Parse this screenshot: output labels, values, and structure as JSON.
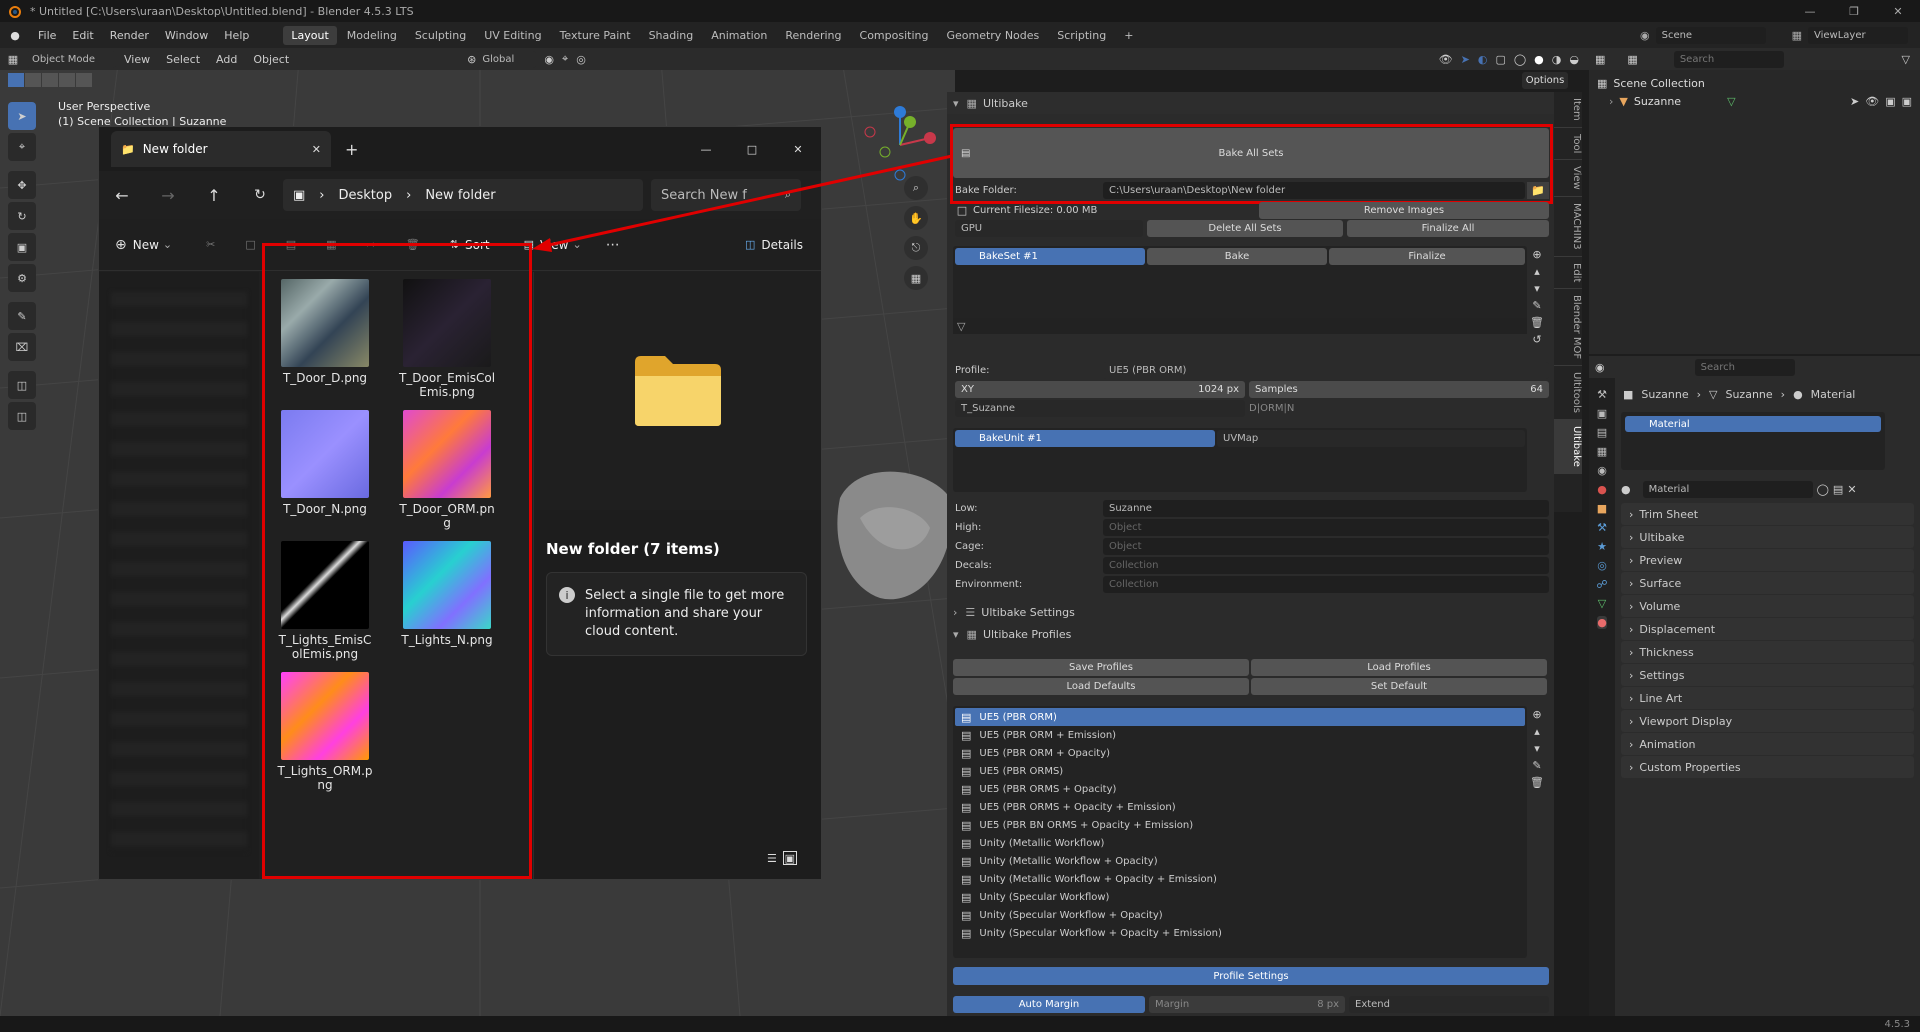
{
  "window": {
    "title": "* Untitled [C:\\Users\\uraan\\Desktop\\Untitled.blend] - Blender 4.5.3 LTS"
  },
  "menu": [
    "File",
    "Edit",
    "Render",
    "Window",
    "Help"
  ],
  "workspaces": [
    "Layout",
    "Modeling",
    "Sculpting",
    "UV Editing",
    "Texture Paint",
    "Shading",
    "Animation",
    "Rendering",
    "Compositing",
    "Geometry Nodes",
    "Scripting"
  ],
  "scene": {
    "name": "Scene",
    "view_layer": "ViewLayer"
  },
  "viewport": {
    "mode": "Object Mode",
    "menu": [
      "View",
      "Select",
      "Add",
      "Object"
    ],
    "transform": "Global",
    "info_line1": "User Perspective",
    "info_line2": "(1) Scene Collection | Suzanne",
    "options": "Options"
  },
  "explorer": {
    "tab_title": "New folder",
    "path": [
      "Desktop",
      "New folder"
    ],
    "search_placeholder": "Search New f",
    "new_label": "New",
    "sort_label": "Sort",
    "view_label": "View",
    "details_label": "Details",
    "files": [
      "T_Door_D.png",
      "T_Door_EmisColEmis.png",
      "T_Door_N.png",
      "T_Door_ORM.png",
      "T_Lights_EmisColEmis.png",
      "T_Lights_N.png",
      "T_Lights_ORM.png"
    ],
    "folder_title": "New folder (7 items)",
    "info_text": "Select a single file to get more information and share your cloud content."
  },
  "ultibake": {
    "panel_title": "Ultibake",
    "bake_all_sets": "Bake All Sets",
    "bake_folder_label": "Bake Folder:",
    "bake_folder_value": "C:\\Users\\uraan\\Desktop\\New folder",
    "current_filesize": "Current Filesize: 0.00 MB",
    "remove_images": "Remove Images",
    "device": "GPU",
    "delete_all_sets": "Delete All Sets",
    "finalize_all": "Finalize All",
    "bakeset_name": "BakeSet #1",
    "bake": "Bake",
    "finalize": "Finalize",
    "profile_label": "Profile:",
    "profile_value": "UE5 (PBR ORM)",
    "xy_label": "XY",
    "xy_value": "1024 px",
    "samples_label": "Samples",
    "samples_value": "64",
    "basename": "T_Suzanne",
    "channels": "D|ORM|N",
    "bakeunit": "BakeUnit #1",
    "uvmap": "UVMap",
    "low_label": "Low:",
    "low_value": "Suzanne",
    "high_label": "High:",
    "high_placeholder": "Object",
    "cage_label": "Cage:",
    "cage_placeholder": "Object",
    "decals_label": "Decals:",
    "decals_placeholder": "Collection",
    "env_label": "Environment:",
    "env_placeholder": "Collection",
    "settings_title": "Ultibake Settings",
    "profiles_title": "Ultibake Profiles",
    "save_profiles": "Save Profiles",
    "load_profiles": "Load Profiles",
    "load_defaults": "Load Defaults",
    "set_default": "Set Default",
    "profiles": [
      "UE5 (PBR ORM)",
      "UE5 (PBR ORM + Emission)",
      "UE5 (PBR ORM + Opacity)",
      "UE5 (PBR ORMS)",
      "UE5 (PBR ORMS + Opacity)",
      "UE5 (PBR ORMS + Opacity + Emission)",
      "UE5 (PBR BN ORMS + Opacity + Emission)",
      "Unity (Metallic Workflow)",
      "Unity (Metallic Workflow + Opacity)",
      "Unity (Metallic Workflow + Opacity + Emission)",
      "Unity (Specular Workflow)",
      "Unity (Specular Workflow + Opacity)",
      "Unity (Specular Workflow + Opacity + Emission)"
    ],
    "profile_settings": "Profile Settings",
    "auto_margin": "Auto Margin",
    "margin_label": "Margin",
    "margin_value": "8 px",
    "extend": "Extend"
  },
  "npanel_tabs": [
    "Item",
    "Tool",
    "View",
    "MACHIN3",
    "Edit",
    "Blender MOF",
    "Ultitools",
    "Ultibake"
  ],
  "outliner": {
    "search_placeholder": "Search",
    "collection": "Scene Collection",
    "object": "Suzanne"
  },
  "properties": {
    "search_placeholder": "Search",
    "breadcrumb": [
      "Suzanne",
      "Suzanne",
      "Material"
    ],
    "slot": "Material",
    "material_name": "Material",
    "sections": [
      "Trim Sheet",
      "Ultibake",
      "Preview",
      "Surface",
      "Volume",
      "Displacement",
      "Thickness",
      "Settings",
      "Line Art",
      "Viewport Display",
      "Animation",
      "Custom Properties"
    ]
  },
  "status": {
    "version": "4.5.3"
  },
  "colors": {
    "accent": "#4772b3",
    "highlight": "#e00000"
  }
}
